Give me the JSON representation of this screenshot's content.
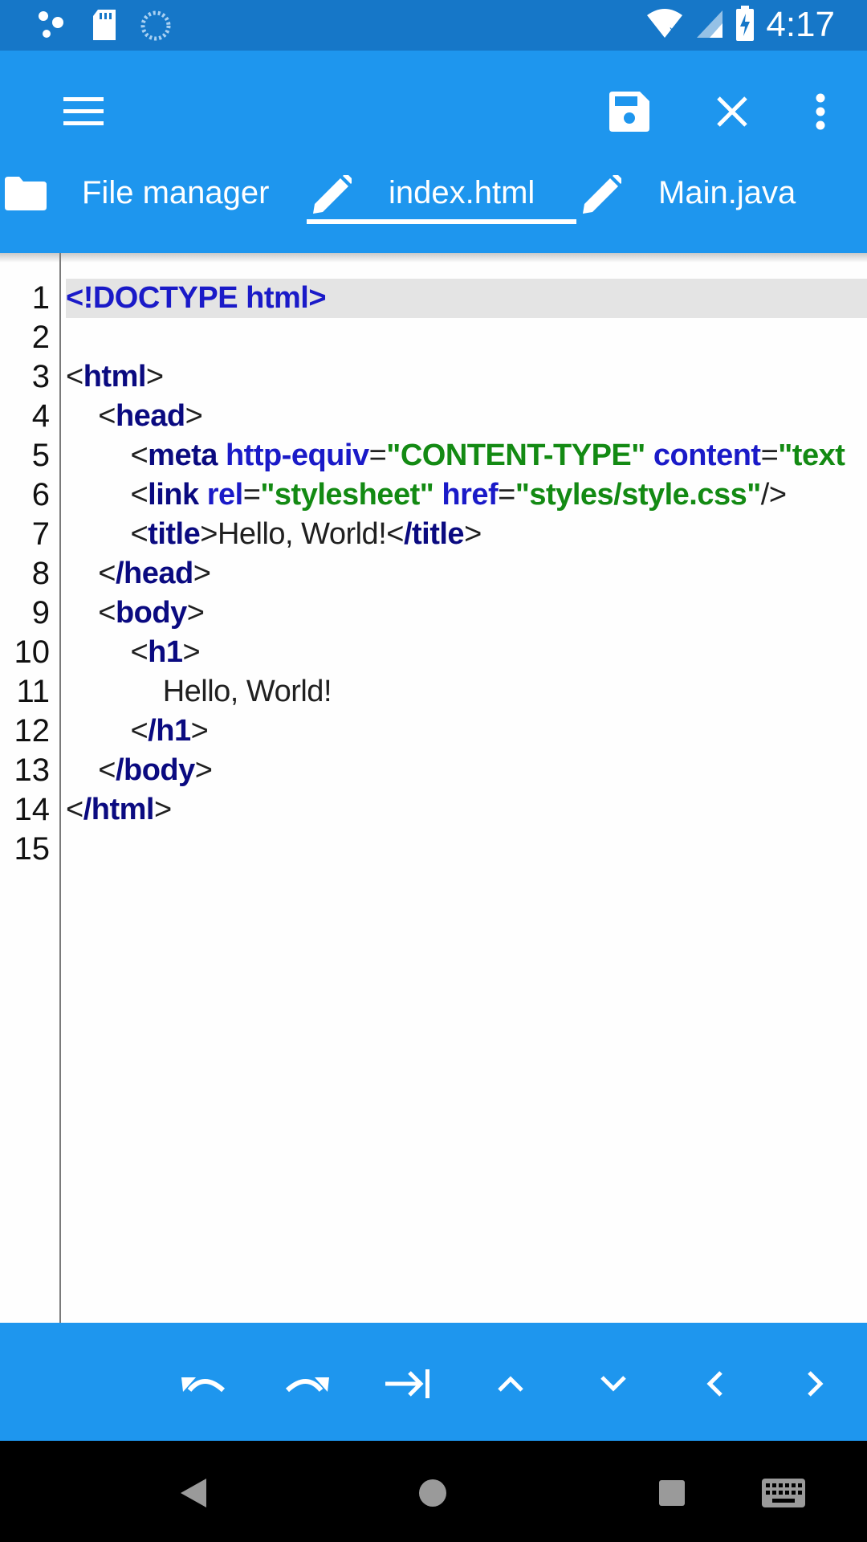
{
  "status_bar": {
    "time": "4:17",
    "icons": [
      "dots-notification-icon",
      "sd-card-icon",
      "sync-icon",
      "wifi-icon",
      "signal-icon",
      "battery-charging-icon"
    ]
  },
  "toolbar": {
    "icons": [
      "hamburger-menu-icon",
      "save-icon",
      "close-icon",
      "more-vert-icon"
    ]
  },
  "tabs": [
    {
      "label": "File manager",
      "icon": "folder-icon",
      "active": false
    },
    {
      "label": "index.html",
      "icon": "pencil-icon",
      "active": true
    },
    {
      "label": "Main.java",
      "icon": "pencil-icon",
      "active": false
    }
  ],
  "editor": {
    "line_numbers": [
      "1",
      "2",
      "3",
      "4",
      "5",
      "6",
      "7",
      "8",
      "9",
      "10",
      "11",
      "12",
      "13",
      "14",
      "15"
    ],
    "lines": [
      "<!DOCTYPE html>",
      "",
      "<html>",
      "    <head>",
      "        <meta http-equiv=\"CONTENT-TYPE\" content=\"text",
      "        <link rel=\"stylesheet\" href=\"styles/style.css\"/>",
      "        <title>Hello, World!</title>",
      "    </head>",
      "    <body>",
      "        <h1>",
      "            Hello, World!",
      "        </h1>",
      "    </body>",
      "</html>",
      ""
    ],
    "highlighted_line": 1,
    "colors": {
      "tag": "#0a0a80",
      "attr": "#1a1ac8",
      "string": "#138a13",
      "doctype": "#1a1ac8"
    }
  },
  "bottom_toolbar": {
    "icons": [
      "undo-icon",
      "redo-icon",
      "tab-indent-icon",
      "chevron-up-icon",
      "chevron-down-icon",
      "chevron-left-icon",
      "chevron-right-icon"
    ]
  },
  "nav_bar": {
    "icons": [
      "back-icon",
      "home-icon",
      "recents-icon",
      "keyboard-icon"
    ]
  },
  "colors": {
    "status_bar": "#1677c8",
    "primary": "#1e96ee",
    "background": "#fefefe"
  }
}
